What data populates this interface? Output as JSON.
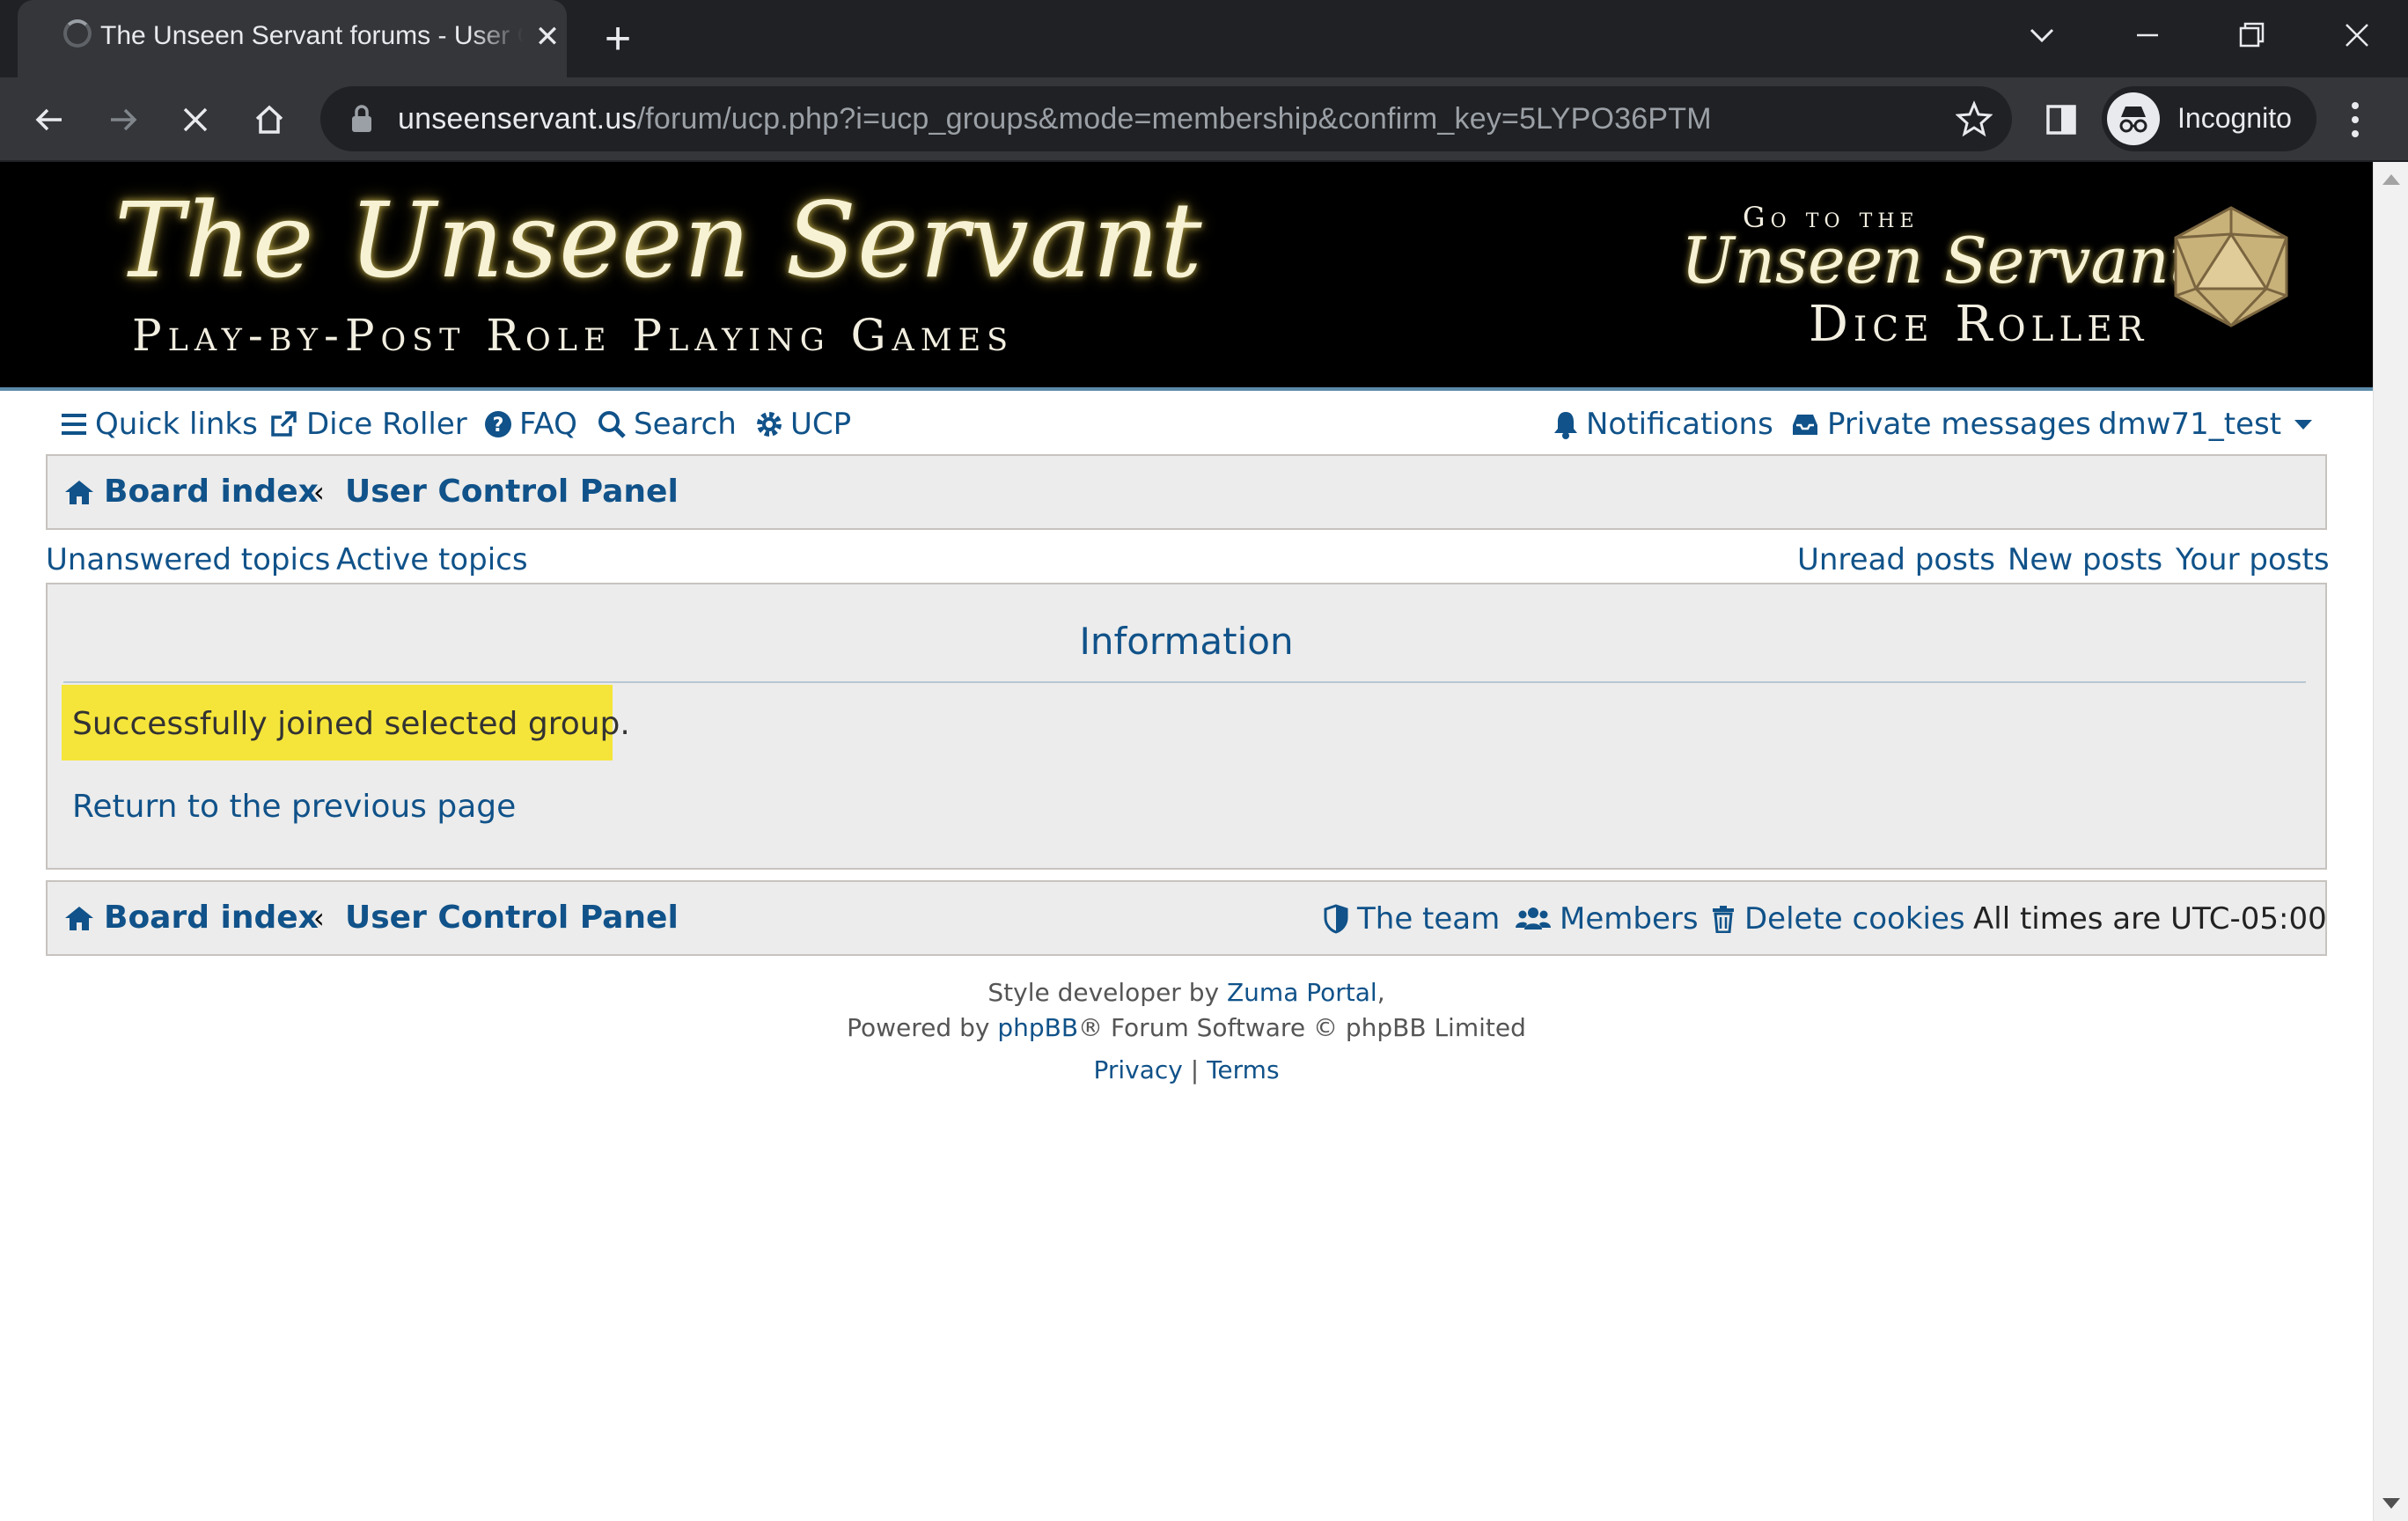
{
  "browser": {
    "tab_title": "The Unseen Servant forums - User Control Panel",
    "tab_close": "✕",
    "new_tab": "+",
    "url_host": "unseenservant.us",
    "url_path": "/forum/ucp.php?i=ucp_groups&mode=membership&confirm_key=5LYPO36PTM",
    "profile_label": "Incognito"
  },
  "banner": {
    "logo_title": "The Unseen Servant",
    "logo_subtitle": "Play-by-Post Role Playing Games",
    "dice_go": "Go to the",
    "dice_name": "Unseen Servant",
    "dice_roller": "Dice Roller"
  },
  "navbar": {
    "quick_links": "Quick links",
    "dice_roller": "Dice Roller",
    "faq": "FAQ",
    "search": "Search",
    "ucp": "UCP",
    "notifications": "Notifications",
    "private_messages": "Private messages",
    "username": "dmw71_test"
  },
  "breadcrumb": {
    "board_index": "Board index",
    "separator": "‹",
    "ucp": "User Control Panel"
  },
  "quicknav": {
    "unanswered": "Unanswered topics",
    "active": "Active topics",
    "unread": "Unread posts",
    "new": "New posts",
    "yours": "Your posts"
  },
  "info_panel": {
    "title": "Information",
    "message": "Successfully joined selected group.",
    "return_link": "Return to the previous page"
  },
  "footer_bar": {
    "board_index": "Board index",
    "separator": "‹",
    "ucp": "User Control Panel",
    "team": "The team",
    "members": "Members",
    "delete_cookies": "Delete cookies",
    "timezone": "All times are UTC-05:00"
  },
  "credits": {
    "style_prefix": "Style developer by",
    "style_link": "Zuma Portal",
    "style_suffix": ",",
    "powered_prefix": "Powered by",
    "powered_link": "phpBB",
    "powered_suffix": "® Forum Software © phpBB Limited",
    "privacy": "Privacy",
    "divider": "|",
    "terms": "Terms"
  },
  "colors": {
    "link": "#105289",
    "highlight": "#f5e53a",
    "panel_bg": "#ececec",
    "chrome_dark": "#202124"
  }
}
